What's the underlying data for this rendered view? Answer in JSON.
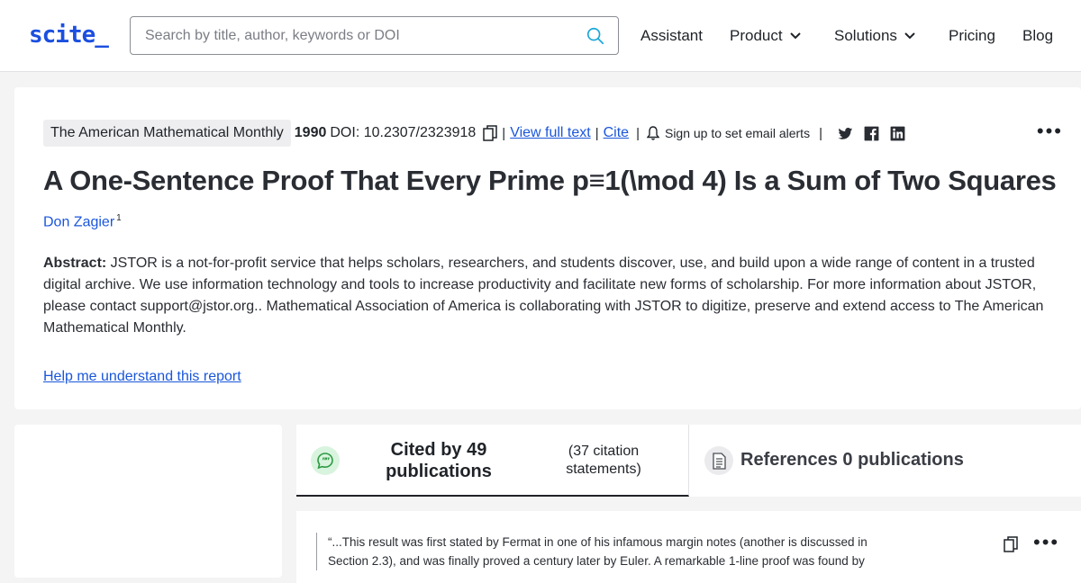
{
  "header": {
    "logo": "scite_",
    "search_placeholder": "Search by title, author, keywords or DOI",
    "nav": {
      "assistant": "Assistant",
      "product": "Product",
      "solutions": "Solutions",
      "pricing": "Pricing",
      "blog": "Blog"
    }
  },
  "article": {
    "journal": "The American Mathematical Monthly",
    "year": "1990",
    "doi": "DOI: 10.2307/2323918",
    "view_full_text": "View full text",
    "cite": "Cite",
    "alert_label": "Sign up to set email alerts",
    "title": "A One-Sentence Proof That Every Prime p≡1(\\mod 4) Is a Sum of Two Squares",
    "author": "Don Zagier",
    "author_sup": "1",
    "abstract_label": "Abstract:",
    "abstract_text": " JSTOR is a not-for-profit service that helps scholars, researchers, and students discover, use, and build upon a wide range of content in a trusted digital archive. We use information technology and tools to increase productivity and facilitate new forms of scholarship. For more information about JSTOR, please contact support@jstor.org.. Mathematical Association of America is collaborating with JSTOR to digitize, preserve and extend access to The American Mathematical Monthly.",
    "help_link": "Help me understand this report"
  },
  "tabs": {
    "cited_main": "Cited by 49 publications",
    "cited_sub": "(37 citation statements)",
    "refs": "References 0 publications"
  },
  "quote": {
    "text": "“...This result was first stated by Fermat in one of his infamous margin notes (another is discussed in Section 2.3), and was finally proved a century later by Euler. A remarkable 1-line proof was found by"
  },
  "icons": {
    "search": "search-icon",
    "chevron": "chevron-down-icon",
    "copy": "copy-icon",
    "bell": "bell-icon",
    "twitter": "twitter-icon",
    "facebook": "facebook-icon",
    "linkedin": "linkedin-icon",
    "more": "more-icon",
    "chat": "chat-bubble-icon",
    "document": "document-icon"
  },
  "colors": {
    "brand": "#1b4fe0",
    "link": "#1a56db",
    "cited_bubble": "#d9f4de"
  }
}
